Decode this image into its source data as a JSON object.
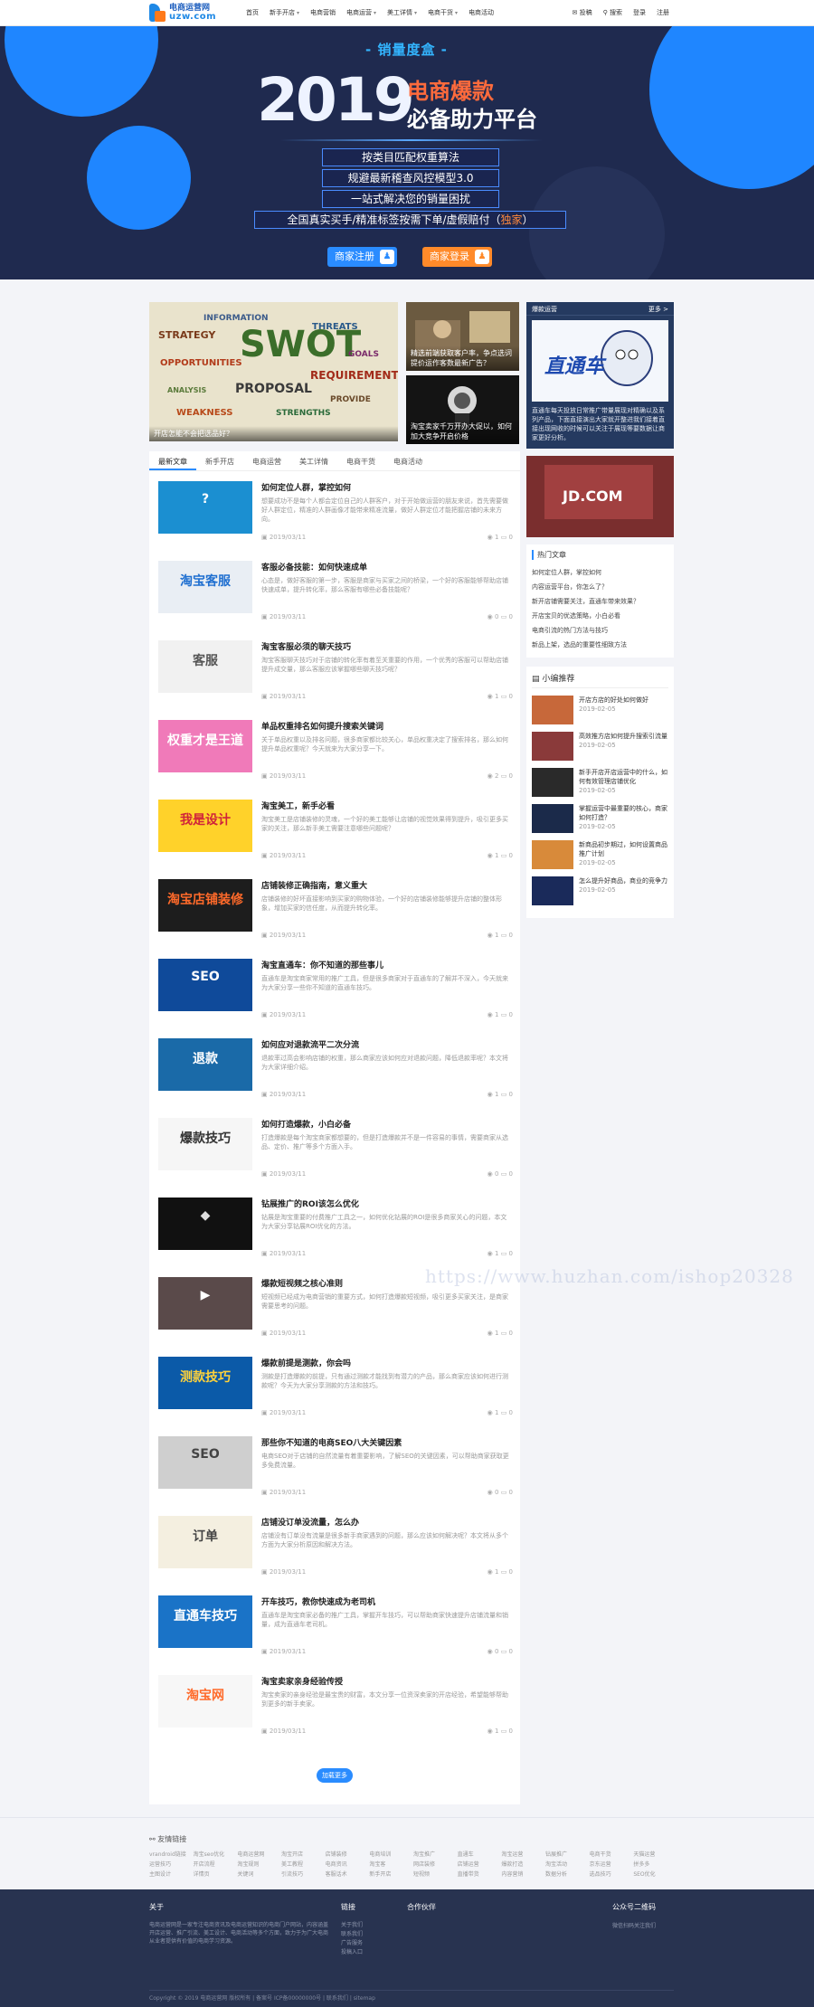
{
  "nav": {
    "logo_line1": "电商运营网",
    "logo_line2": "uzw.com",
    "items": [
      {
        "label": "首页",
        "dropdown": false
      },
      {
        "label": "新手开店",
        "dropdown": true
      },
      {
        "label": "电商营销",
        "dropdown": false
      },
      {
        "label": "电商运营",
        "dropdown": true
      },
      {
        "label": "美工详情",
        "dropdown": true
      },
      {
        "label": "电商干货",
        "dropdown": true
      },
      {
        "label": "电商活动",
        "dropdown": false
      }
    ],
    "right": [
      "✉ 投稿",
      "⚲ 搜索",
      "登录",
      "注册"
    ]
  },
  "hero": {
    "tag": "- 销量度盒 -",
    "year": "2019",
    "title1": "电商爆款",
    "title2": "必备助力平台",
    "features": [
      "按类目匹配权重算法",
      "规避最新稽查风控模型3.0",
      "一站式解决您的销量困扰"
    ],
    "feature4_prefix": "全国真实买手/精准标签按需下单/虚假赔付（",
    "feature4_highlight": "独家",
    "feature4_suffix": "）",
    "btn_register": "商家注册",
    "btn_login": "商家登录"
  },
  "gallery": {
    "big_caption": "开店怎能不会把选品好？",
    "small1_caption": "精选前端获取客户率，争点选词提价运作客数最新广告？",
    "small2_caption": "淘宝卖家千万开办大促以，如何加大竞争开启价格"
  },
  "sidebar": {
    "ad_header": "爆款运营",
    "ad_more": "更多 >",
    "ad_text": "直通车每天投放日常推广带量展现对精确以及系列产品，下面直接演出大家就开整进我们接着直接出现网收的时候可以关注于展现等要数据让商家更好分析。",
    "hot_title": "热门文章",
    "hot_items": [
      "如何定位人群，掌控如何",
      "内容运营平台，你怎么了？",
      "新开店铺需要关注，直通车带来效果？",
      "开店宝贝的优选策略，小白必看",
      "电商引流的热门方法与技巧",
      "新品上架，选品的重要性细致方法"
    ],
    "small_title": "小编推荐",
    "small_items": [
      {
        "title": "开店方店的好处如何做好",
        "date": "2019-02-05"
      },
      {
        "title": "高效推方店如何提升搜索引流量",
        "date": "2019-02-05"
      },
      {
        "title": "新手开店开店运营中的什么，如何有效管理店铺优化",
        "date": "2019-02-05"
      },
      {
        "title": "掌握运营中最重要的核心，商家如何打造？",
        "date": "2019-02-05"
      },
      {
        "title": "新商品初步期过，如何设置商品推广计划",
        "date": "2019-02-05"
      },
      {
        "title": "怎么提升好商品，商业的竞争力",
        "date": "2019-02-05"
      }
    ]
  },
  "tabs": [
    "最新文章",
    "新手开店",
    "电商运营",
    "美工详情",
    "电商干货",
    "电商活动"
  ],
  "articles": [
    {
      "title": "如何定位人群，掌控如何",
      "summary": "想要成功不是每个人都会定位自己的人群客户，对于开始做运营的朋友来说，首先需要做好人群定位，精准的人群画像才能带来精准流量，做好人群定位才能把握店铺的未来方向。",
      "date": "2019/03/11",
      "count": "1"
    },
    {
      "title": "客服必备技能：如何快速成单",
      "summary": "心态是，做好客服的第一步，客服是商家与买家之间的桥梁，一个好的客服能够帮助店铺快速成单，提升转化率，那么客服有哪些必备技能呢？",
      "date": "2019/03/11",
      "count": "0"
    },
    {
      "title": "淘宝客服必须的聊天技巧",
      "summary": "淘宝客服聊天技巧对于店铺的转化率有着至关重要的作用，一个优秀的客服可以帮助店铺提升成交量，那么客服应该掌握哪些聊天技巧呢？",
      "date": "2019/03/11",
      "count": "1"
    },
    {
      "title": "单品权重排名如何提升搜索关键词",
      "summary": "关于单品权重以及排名问题，很多商家都比较关心，单品权重决定了搜索排名，那么如何提升单品权重呢？今天就来为大家分享一下。",
      "date": "2019/03/11",
      "count": "2"
    },
    {
      "title": "淘宝美工，新手必看",
      "summary": "淘宝美工是店铺装修的灵魂，一个好的美工能够让店铺的视觉效果得到提升，吸引更多买家的关注，那么新手美工需要注意哪些问题呢？",
      "date": "2019/03/11",
      "count": "1"
    },
    {
      "title": "店铺装修正确指南，意义重大",
      "summary": "店铺装修的好坏直接影响到买家的购物体验，一个好的店铺装修能够提升店铺的整体形象，增加买家的信任度，从而提升转化率。",
      "date": "2019/03/11",
      "count": "1"
    },
    {
      "title": "淘宝直通车：你不知道的那些事儿",
      "summary": "直通车是淘宝商家常用的推广工具，但是很多商家对于直通车的了解并不深入，今天就来为大家分享一些你不知道的直通车技巧。",
      "date": "2019/03/11",
      "count": "1"
    },
    {
      "title": "如何应对退款流平二次分流",
      "summary": "退款率过高会影响店铺的权重，那么商家应该如何应对退款问题，降低退款率呢？本文将为大家详细介绍。",
      "date": "2019/03/11",
      "count": "1"
    },
    {
      "title": "如何打造爆款，小白必备",
      "summary": "打造爆款是每个淘宝商家都想要的，但是打造爆款并不是一件容易的事情，需要商家从选品、定价、推广等多个方面入手。",
      "date": "2019/03/11",
      "count": "0"
    },
    {
      "title": "钻展推广的ROI该怎么优化",
      "summary": "钻展是淘宝重要的付费推广工具之一，如何优化钻展的ROI是很多商家关心的问题，本文为大家分享钻展ROI优化的方法。",
      "date": "2019/03/11",
      "count": "1"
    },
    {
      "title": "爆款短视频之核心准则",
      "summary": "短视频已经成为电商营销的重要方式，如何打造爆款短视频，吸引更多买家关注，是商家需要思考的问题。",
      "date": "2019/03/11",
      "count": "1"
    },
    {
      "title": "爆款前提是测款，你会吗",
      "summary": "测款是打造爆款的前提，只有通过测款才能找到有潜力的产品，那么商家应该如何进行测款呢？今天为大家分享测款的方法和技巧。",
      "date": "2019/03/11",
      "count": "1"
    },
    {
      "title": "那些你不知道的电商SEO八大关键因素",
      "summary": "电商SEO对于店铺的自然流量有着重要影响，了解SEO的关键因素，可以帮助商家获取更多免费流量。",
      "date": "2019/03/11",
      "count": "0"
    },
    {
      "title": "店铺没订单没流量，怎么办",
      "summary": "店铺没有订单没有流量是很多新手商家遇到的问题，那么应该如何解决呢？本文将从多个方面为大家分析原因和解决方法。",
      "date": "2019/03/11",
      "count": "1"
    },
    {
      "title": "开车技巧，教你快速成为老司机",
      "summary": "直通车是淘宝商家必备的推广工具，掌握开车技巧，可以帮助商家快速提升店铺流量和销量，成为直通车老司机。",
      "date": "2019/03/11",
      "count": "0"
    },
    {
      "title": "淘宝卖家亲身经验传授",
      "summary": "淘宝卖家的亲身经验是最宝贵的财富，本文分享一位资深卖家的开店经验，希望能够帮助到更多的新手卖家。",
      "date": "2019/03/11",
      "count": "1"
    }
  ],
  "more_label": "加载更多",
  "friend": {
    "title": "友情链接",
    "links": [
      "vrandroid链接",
      "淘宝seo优化",
      "电商运营网",
      "淘宝开店",
      "店铺装修",
      "电商培训",
      "淘宝推广",
      "直通车",
      "淘宝运营",
      "钻展推广",
      "电商干货",
      "天猫运营",
      "运营技巧",
      "开店流程",
      "淘宝规则",
      "美工教程",
      "电商资讯",
      "淘宝客",
      "网店装修",
      "店铺运营",
      "爆款打造",
      "淘宝活动",
      "京东运营",
      "拼多多",
      "主图设计",
      "详情页",
      "关键词",
      "引流技巧",
      "客服话术",
      "新手开店",
      "短视频",
      "直播带货",
      "内容营销",
      "数据分析",
      "选品技巧",
      "SEO优化"
    ]
  },
  "footer": {
    "about_title": "关于",
    "about_text": "电商运营网是一家专注电商资讯及电商运营知识的电商门户网站，内容涵盖开店运营、推广引流、美工设计、电商活动等多个方面，致力于为广大电商从业者提供有价值的电商学习资源。",
    "links_title": "链接",
    "links": [
      "关于我们",
      "联系我们",
      "广告服务",
      "投稿入口"
    ],
    "partner_title": "合作伙伴",
    "qr_title": "公众号二维码",
    "qr_text": "微信扫码关注我们",
    "copyright": "Copyright © 2019 电商运营网 版权所有 | 备案号 ICP备00000000号 | 联系我们 | sitemap"
  },
  "watermark": "https://www.huzhan.com/ishop20328"
}
